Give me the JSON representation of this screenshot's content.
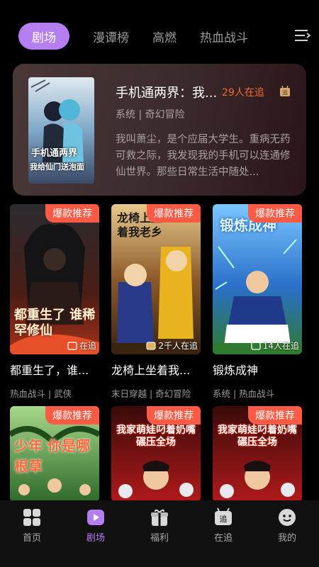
{
  "tabs": [
    {
      "label": "剧场",
      "active": true
    },
    {
      "label": "漫谭榜",
      "active": false
    },
    {
      "label": "高燃",
      "active": false
    },
    {
      "label": "热血战斗",
      "active": false
    }
  ],
  "featured": {
    "title": "手机通两界：我...",
    "follow_count": "29人在追",
    "tags": "系统 | 奇幻冒险",
    "description": "我叫萧尘，是个应届大学生。重病无药可救之际，我发现我的手机可以连通修仙世界。那些日常生活中随处...",
    "cover_text_line1": "手机通两界",
    "cover_text_line2": "我给仙门送泡面"
  },
  "cards": [
    {
      "badge": "爆款推荐",
      "title": "都重生了，谁...",
      "tags": "热血战斗 | 武侠",
      "overlay": "在追",
      "cover_text": "都重生了 谁稀罕修仙"
    },
    {
      "badge": "爆款推荐",
      "title": "龙椅上坐着我...",
      "tags": "末日穿越 | 奇幻冒险",
      "overlay": "2千人在追",
      "cover_text": "龙椅上坐着我老乡"
    },
    {
      "badge": "爆款推荐",
      "title": "锻炼成神",
      "tags": "系统 | 热血战斗",
      "overlay": "14人在追",
      "cover_text": "锻炼成神"
    },
    {
      "badge": "爆款推荐",
      "title": "",
      "tags": "",
      "overlay": "",
      "cover_text": "少年 你是哪根草"
    },
    {
      "badge": "爆款推荐",
      "title": "",
      "tags": "",
      "overlay": "",
      "cover_text": "我家萌娃叼着奶嘴碾压全场"
    },
    {
      "badge": "爆款推荐",
      "title": "",
      "tags": "",
      "overlay": "",
      "cover_text": "我家萌娃叼着奶嘴碾压全场"
    }
  ],
  "nav": [
    {
      "label": "首页",
      "icon": "home-grid-icon",
      "active": false
    },
    {
      "label": "剧场",
      "icon": "play-icon",
      "active": true
    },
    {
      "label": "福利",
      "icon": "gift-icon",
      "active": false
    },
    {
      "label": "在追",
      "icon": "follow-icon",
      "active": false
    },
    {
      "label": "我的",
      "icon": "profile-icon",
      "active": false
    }
  ],
  "colors": {
    "accent": "#b57ff2",
    "hot": "#ff5a44",
    "follow": "#f26b2b"
  }
}
